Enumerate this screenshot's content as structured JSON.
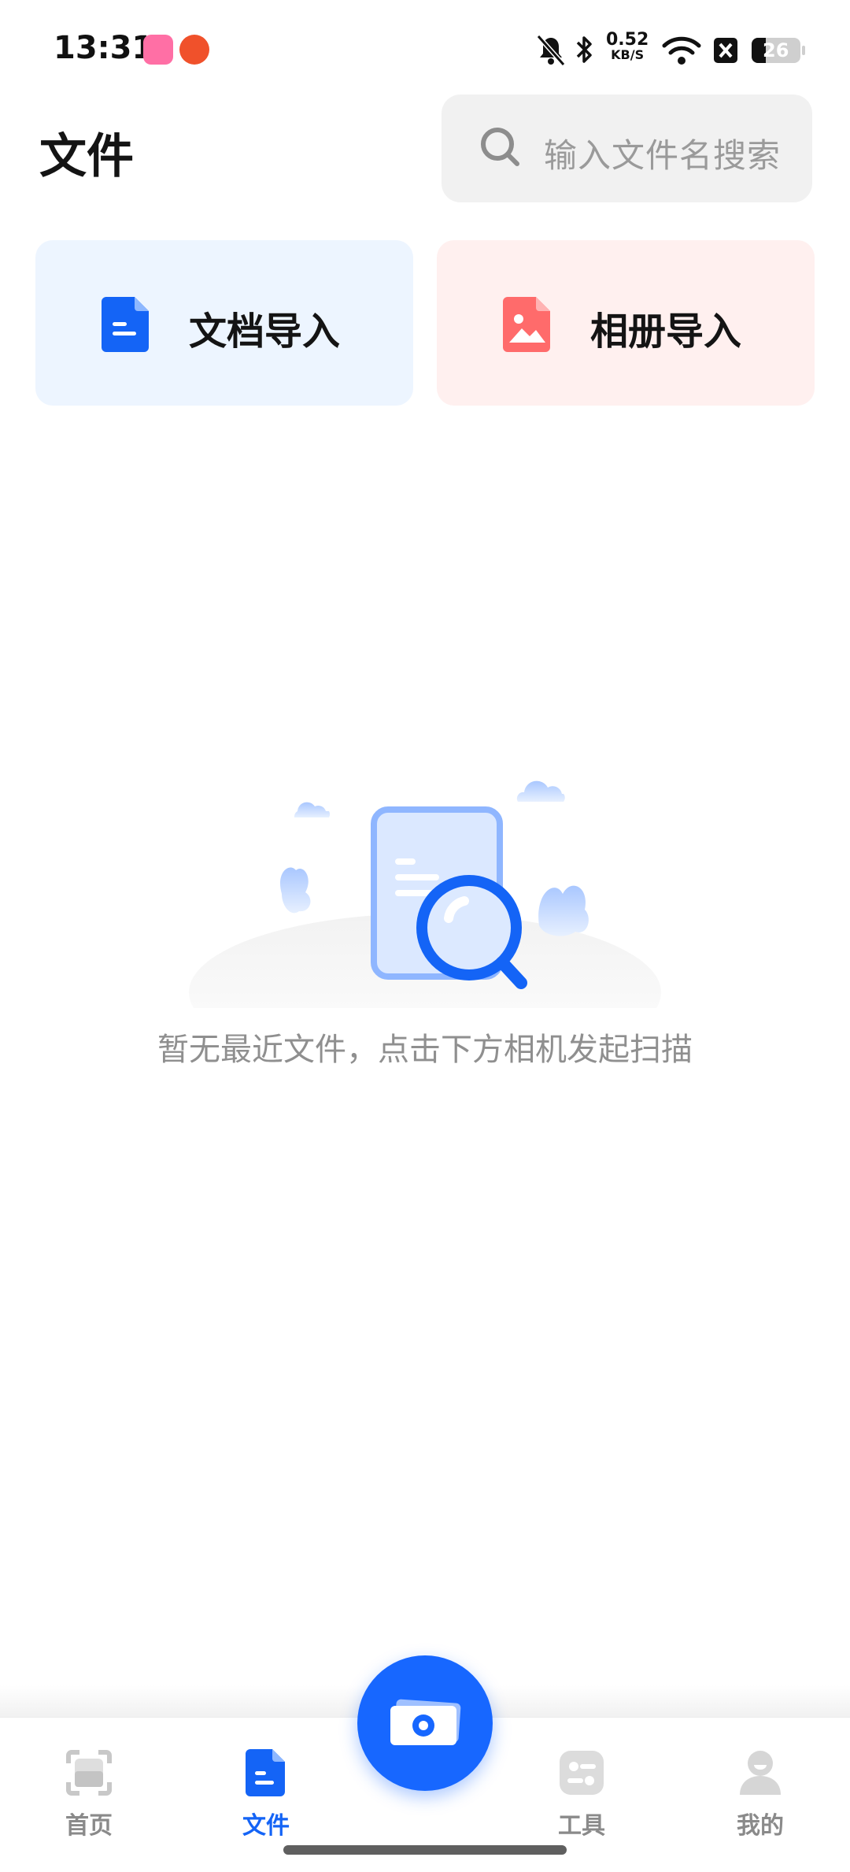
{
  "status_bar": {
    "time": "13:31",
    "net_speed": "0.52",
    "net_unit": "KB/S",
    "battery": "26",
    "icons": [
      "bilibili-app-icon",
      "app-notification-icon",
      "mute-icon",
      "bluetooth-icon",
      "wifi-icon",
      "close-box-icon",
      "battery-icon"
    ]
  },
  "header": {
    "title": "文件",
    "search_placeholder": "输入文件名搜索"
  },
  "import": {
    "doc_label": "文档导入",
    "album_label": "相册导入"
  },
  "empty_state": {
    "message": "暂无最近文件，点击下方相机发起扫描"
  },
  "bottom_nav": {
    "items": [
      {
        "label": "首页",
        "icon": "scan-home-icon"
      },
      {
        "label": "文件",
        "icon": "file-icon",
        "active": true
      },
      {
        "label": "工具",
        "icon": "tools-icon"
      },
      {
        "label": "我的",
        "icon": "profile-icon"
      }
    ],
    "fab_icon": "camera-icon"
  },
  "colors": {
    "accent": "#1767ff",
    "doc_card_bg": "#edf5ff",
    "album_card_bg": "#fff0ef",
    "album_icon": "#ff6b6b"
  }
}
